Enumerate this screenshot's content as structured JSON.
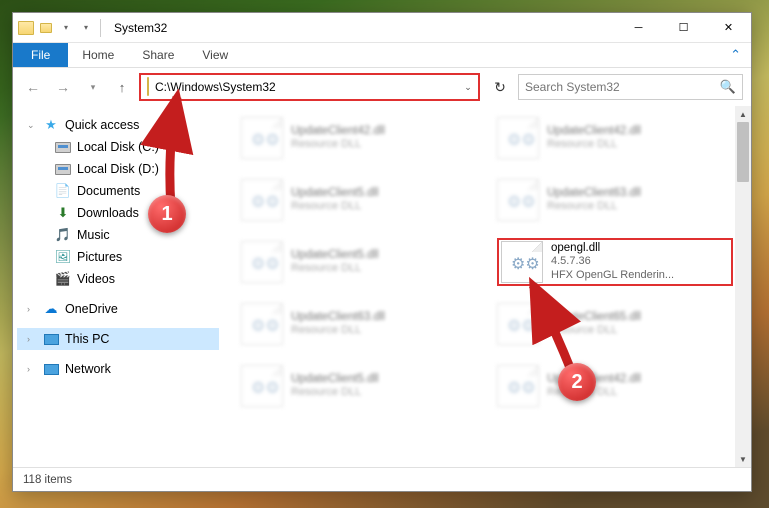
{
  "window": {
    "title": "System32"
  },
  "ribbon": {
    "file": "File",
    "tabs": [
      "Home",
      "Share",
      "View"
    ]
  },
  "nav": {
    "path": "C:\\Windows\\System32",
    "search_placeholder": "Search System32"
  },
  "sidebar": {
    "quick": {
      "label": "Quick access",
      "items": [
        {
          "label": "Local Disk (C:)",
          "icon": "drive"
        },
        {
          "label": "Local Disk (D:)",
          "icon": "drive"
        },
        {
          "label": "Documents",
          "icon": "doc"
        },
        {
          "label": "Downloads",
          "icon": "down"
        },
        {
          "label": "Music",
          "icon": "music"
        },
        {
          "label": "Pictures",
          "icon": "pic"
        },
        {
          "label": "Videos",
          "icon": "vid"
        }
      ]
    },
    "onedrive": {
      "label": "OneDrive"
    },
    "thispc": {
      "label": "This PC"
    },
    "network": {
      "label": "Network"
    }
  },
  "files": [
    {
      "name": "UpdateClient42.dll",
      "sub1": "Resource DLL",
      "sub2": ""
    },
    {
      "name": "UpdateClient42.dll",
      "sub1": "Resource DLL",
      "sub2": ""
    },
    {
      "name": "UpdateClient5.dll",
      "sub1": "Resource DLL",
      "sub2": ""
    },
    {
      "name": "UpdateClient63.dll",
      "sub1": "Resource DLL",
      "sub2": ""
    },
    {
      "name": "UpdateClient5.dll",
      "sub1": "Resource DLL",
      "sub2": ""
    },
    {
      "name": "opengl.dll",
      "sub1": "4.5.7.36",
      "sub2": "HFX OpenGL Renderin...",
      "highlight": true
    },
    {
      "name": "UpdateClient63.dll",
      "sub1": "Resource DLL",
      "sub2": ""
    },
    {
      "name": "UpdateClient65.dll",
      "sub1": "Resource DLL",
      "sub2": ""
    },
    {
      "name": "UpdateClient5.dll",
      "sub1": "Resource DLL",
      "sub2": ""
    },
    {
      "name": "UpdateClient42.dll",
      "sub1": "Resource DLL",
      "sub2": ""
    }
  ],
  "status": {
    "items": "118 items"
  },
  "annotations": {
    "one": "1",
    "two": "2"
  }
}
